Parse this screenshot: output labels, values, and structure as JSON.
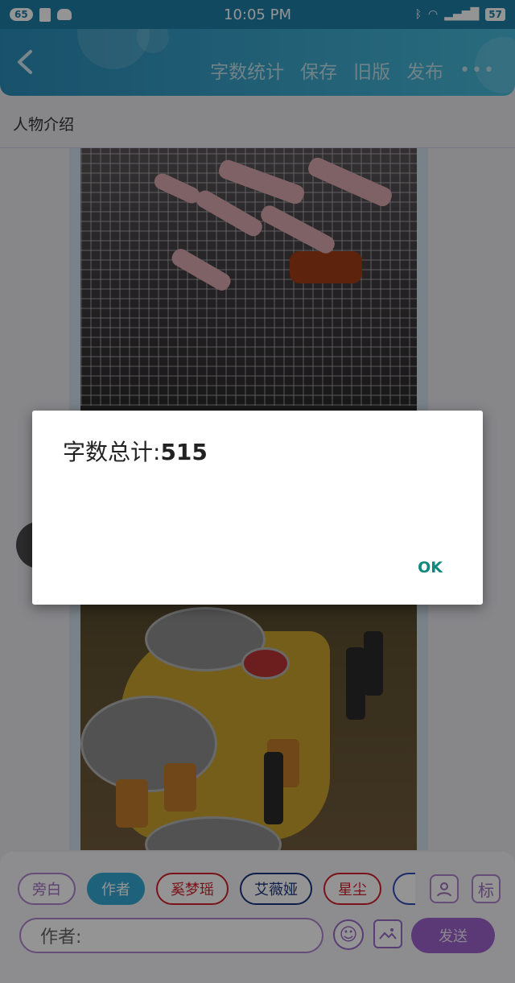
{
  "status_bar": {
    "notif_count": "65",
    "time": "10:05 PM",
    "battery": "57"
  },
  "header": {
    "back_icon": "chevron-left-icon",
    "actions": [
      "字数统计",
      "保存",
      "旧版",
      "发布"
    ],
    "more_label": "•••"
  },
  "section": {
    "title": "人物介绍"
  },
  "dialog": {
    "label": "字数总计:",
    "value": "515",
    "ok_label": "OK"
  },
  "bottom": {
    "chips": [
      "旁白",
      "作者",
      "奚梦瑶",
      "艾薇娅",
      "星尘"
    ],
    "selected_chip": "作者",
    "contact_icon": "contact-card-icon",
    "tag_label": "标",
    "input_value": "作者:",
    "emoji_icon": "smiley-icon",
    "image_icon": "image-icon",
    "send_label": "发送"
  },
  "colors": {
    "header": "#2a8cb8",
    "accent_purple": "#9b62cc",
    "selected_chip": "#33a8d3",
    "ok_text": "#12887c"
  }
}
